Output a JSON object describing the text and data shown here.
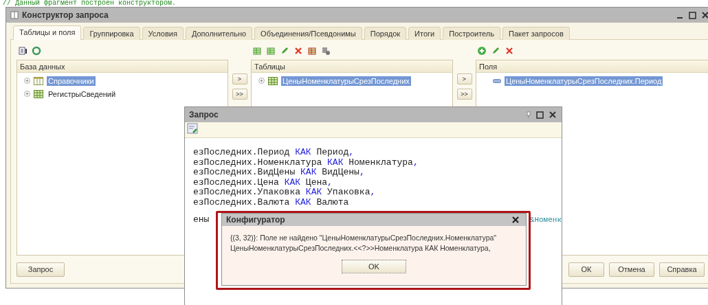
{
  "editor_comment": "// Данный фрагмент построен конструктором.",
  "main_window": {
    "title": "Конструктор запроса",
    "tabs": [
      {
        "label": "Таблицы и поля",
        "selected": true
      },
      {
        "label": "Группировка",
        "selected": false
      },
      {
        "label": "Условия",
        "selected": false
      },
      {
        "label": "Дополнительно",
        "selected": false
      },
      {
        "label": "Объединения/Псевдонимы",
        "selected": false
      },
      {
        "label": "Порядок",
        "selected": false
      },
      {
        "label": "Итоги",
        "selected": false
      },
      {
        "label": "Построитель",
        "selected": false
      },
      {
        "label": "Пакет запросов",
        "selected": false
      }
    ],
    "panels": [
      {
        "title": "База данных",
        "items": [
          {
            "label": "Справочники",
            "kind": "catalog",
            "selected": true
          },
          {
            "label": "РегистрыСведений",
            "kind": "register",
            "selected": false
          }
        ]
      },
      {
        "title": "Таблицы",
        "items": [
          {
            "label": "ЦеныНоменклатурыСрезПоследних",
            "kind": "register",
            "selected": true
          }
        ]
      },
      {
        "title": "Поля",
        "items": [
          {
            "label": "ЦеныНоменклатурыСрезПоследних.Период",
            "kind": "field",
            "selected": true
          }
        ]
      }
    ],
    "transfer_buttons": [
      ">",
      ">>"
    ],
    "left_buttons": [
      "Запрос"
    ],
    "right_buttons": [
      "ОК",
      "Отмена",
      "Справка"
    ]
  },
  "query_window": {
    "title": "Запрос",
    "code_lines": [
      [
        {
          "kind": "ident",
          "text": "езПоследних.Период"
        },
        {
          "kind": "keyword",
          "text": "КАК"
        },
        {
          "kind": "ident",
          "text": "Период"
        },
        {
          "kind": "punct",
          "text": ","
        }
      ],
      [
        {
          "kind": "ident",
          "text": "езПоследних.Номенклатура"
        },
        {
          "kind": "keyword",
          "text": "КАК"
        },
        {
          "kind": "ident",
          "text": "Номенклатура"
        },
        {
          "kind": "punct",
          "text": ","
        }
      ],
      [
        {
          "kind": "ident",
          "text": "езПоследних.ВидЦены"
        },
        {
          "kind": "keyword",
          "text": "КАК"
        },
        {
          "kind": "ident",
          "text": "ВидЦены"
        },
        {
          "kind": "punct",
          "text": ","
        }
      ],
      [
        {
          "kind": "ident",
          "text": "езПоследних.Цена"
        },
        {
          "kind": "keyword",
          "text": "КАК"
        },
        {
          "kind": "ident",
          "text": "Цена"
        },
        {
          "kind": "punct",
          "text": ","
        }
      ],
      [
        {
          "kind": "ident",
          "text": "езПоследних.Упаковка"
        },
        {
          "kind": "keyword",
          "text": "КАК"
        },
        {
          "kind": "ident",
          "text": "Упаковка"
        },
        {
          "kind": "punct",
          "text": ","
        }
      ],
      [
        {
          "kind": "ident",
          "text": "езПоследних.Валюта"
        },
        {
          "kind": "keyword",
          "text": "КАК"
        },
        {
          "kind": "ident",
          "text": "Валюта"
        }
      ]
    ],
    "hidden_line_left": "ены",
    "hidden_line_right": "&Номенк"
  },
  "dialog": {
    "title": "Конфигуратор",
    "highlighted": true,
    "message_lines": [
      "{(3, 32)}: Поле не найдено \"ЦеныНоменклатурыСрезПоследних.Номенклатура\"",
      "ЦеныНоменклатурыСрезПоследних.<<?>>Номенклатура КАК Номенклатура,"
    ],
    "button": "OK"
  }
}
